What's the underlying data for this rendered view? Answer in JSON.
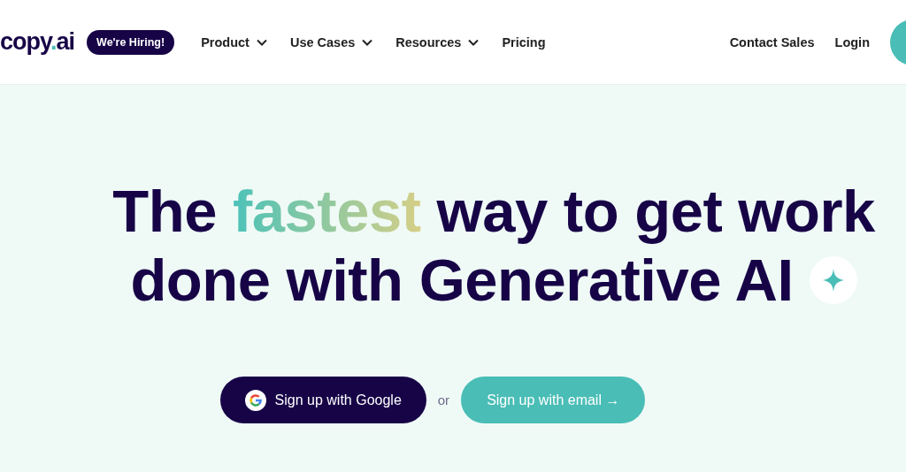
{
  "header": {
    "logo": "copy.ai",
    "badge": "We're Hiring!",
    "nav": [
      {
        "label": "Product",
        "dropdown": true
      },
      {
        "label": "Use Cases",
        "dropdown": true
      },
      {
        "label": "Resources",
        "dropdown": true
      },
      {
        "label": "Pricing",
        "dropdown": false
      }
    ],
    "right_links": [
      "Contact Sales",
      "Login"
    ]
  },
  "hero": {
    "headline_lines": [
      [
        {
          "text": "The ",
          "kind": "plain"
        },
        {
          "text": "fastest",
          "kind": "highlight"
        },
        {
          "text": " way to get work",
          "kind": "plain"
        }
      ],
      [
        {
          "text": "done with Generative AI",
          "kind": "plain"
        }
      ]
    ],
    "google_button": "Sign up with Google",
    "separator": "or",
    "email_button": "Sign up with email →"
  }
}
